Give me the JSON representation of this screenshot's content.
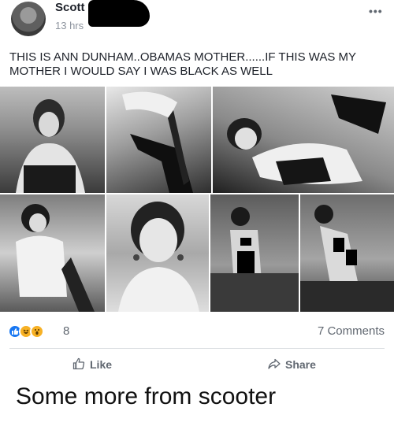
{
  "post": {
    "author": "Scott",
    "time": "13 hrs",
    "more_menu": "•••",
    "text": "THIS IS ANN DUNHAM..OBAMAS MOTHER......IF THIS WAS MY MOTHER I WOULD SAY I WAS BLACK AS WELL"
  },
  "photos": [
    {
      "label": "photo-1"
    },
    {
      "label": "photo-2"
    },
    {
      "label": "photo-3"
    },
    {
      "label": "photo-4"
    },
    {
      "label": "photo-5"
    },
    {
      "label": "photo-6"
    },
    {
      "label": "photo-7"
    }
  ],
  "reactions": {
    "icons": [
      "like-reaction-icon",
      "haha-reaction-icon",
      "wow-reaction-icon"
    ],
    "count": "8",
    "comments": "7 Comments"
  },
  "actions": {
    "like_label": "Like",
    "share_label": "Share"
  },
  "caption": "Some more from scooter",
  "colors": {
    "like_blue": "#1877f2",
    "reaction_yellow": "#f7b125",
    "secondary_text": "#606770",
    "meta_text": "#8d949e",
    "divider": "#dadde1"
  }
}
